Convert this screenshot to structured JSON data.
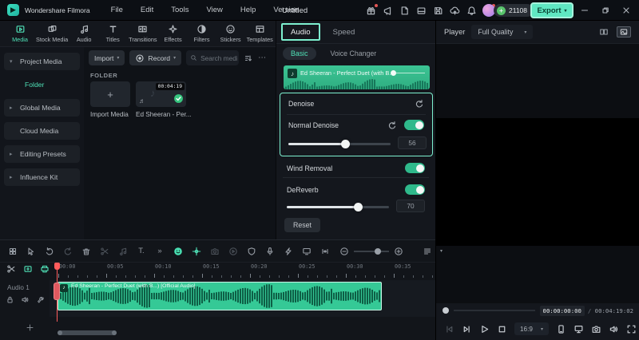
{
  "app": {
    "name": "Wondershare Filmora",
    "menus": [
      {
        "name": "menu-file",
        "label": "File"
      },
      {
        "name": "menu-edit",
        "label": "Edit"
      },
      {
        "name": "menu-tools",
        "label": "Tools"
      },
      {
        "name": "menu-view",
        "label": "View"
      },
      {
        "name": "menu-help",
        "label": "Help"
      },
      {
        "name": "menu-version",
        "label": "Version"
      }
    ],
    "project_title": "Untitled",
    "credits": "21108",
    "export_label": "Export",
    "titlebar_icons": [
      {
        "name": "gift-icon",
        "icon": "gift",
        "dot": true
      },
      {
        "name": "promote-icon",
        "icon": "megaphone"
      },
      {
        "name": "script-icon",
        "icon": "docedit"
      },
      {
        "name": "workspace-icon",
        "icon": "panel"
      },
      {
        "name": "save-icon",
        "icon": "save"
      },
      {
        "name": "cloud-upload-icon",
        "icon": "cloudup"
      },
      {
        "name": "notifications-icon",
        "icon": "bell"
      },
      {
        "name": "apps-icon",
        "icon": "grid",
        "dot": true
      }
    ],
    "window_controls": [
      {
        "name": "minimize-button",
        "icon": "minimize"
      },
      {
        "name": "maximize-button",
        "icon": "maxrestore"
      },
      {
        "name": "close-button",
        "icon": "close"
      }
    ]
  },
  "media_tabs": [
    {
      "name": "tab-media",
      "label": "Media",
      "icon": "mediaicon",
      "active": true
    },
    {
      "name": "tab-stock-media",
      "label": "Stock Media",
      "icon": "stock"
    },
    {
      "name": "tab-audio",
      "label": "Audio",
      "icon": "audionote"
    },
    {
      "name": "tab-titles",
      "label": "Titles",
      "icon": "titles"
    },
    {
      "name": "tab-transitions",
      "label": "Transitions",
      "icon": "transitions"
    },
    {
      "name": "tab-effects",
      "label": "Effects",
      "icon": "fx"
    },
    {
      "name": "tab-filters",
      "label": "Filters",
      "icon": "filters"
    },
    {
      "name": "tab-stickers",
      "label": "Stickers",
      "icon": "stickers"
    },
    {
      "name": "tab-templates",
      "label": "Templates",
      "icon": "templates"
    }
  ],
  "sidebar": [
    {
      "name": "sidebar-item-project-media",
      "label": "Project Media",
      "chevron": "▾"
    },
    {
      "name": "sidebar-item-folder",
      "label": "Folder",
      "active": true,
      "indent": true
    },
    {
      "name": "sidebar-item-global-media",
      "label": "Global Media",
      "chevron": "▸"
    },
    {
      "name": "sidebar-item-cloud-media",
      "label": "Cloud Media"
    },
    {
      "name": "sidebar-item-editing-presets",
      "label": "Editing Presets",
      "chevron": "▸"
    },
    {
      "name": "sidebar-item-influence-kit",
      "label": "Influence Kit",
      "chevron": "▸"
    }
  ],
  "media_panel": {
    "import_label": "Import",
    "record_label": "Record",
    "search_placeholder": "Search media",
    "folder_label": "FOLDER",
    "import_card_label": "Import Media",
    "audio_card": {
      "label": "Ed Sheeran - Per...",
      "duration": "00:04:19"
    }
  },
  "properties": {
    "tabs": [
      {
        "name": "tab-audio-properties",
        "label": "Audio",
        "active": true
      },
      {
        "name": "tab-speed",
        "label": "Speed"
      }
    ],
    "subtabs": [
      {
        "name": "subtab-basic",
        "label": "Basic",
        "active": true
      },
      {
        "name": "subtab-voice-changer",
        "label": "Voice Changer"
      }
    ],
    "clip_title": "Ed Sheeran - Perfect Duet (with B...",
    "denoise_title": "Denoise",
    "normal_denoise": {
      "label": "Normal Denoise",
      "value": 56,
      "max": 100
    },
    "wind_removal_label": "Wind Removal",
    "dereverb": {
      "label": "DeReverb",
      "value": 70,
      "max": 100
    },
    "reset_label": "Reset"
  },
  "player": {
    "label": "Player",
    "quality": "Full Quality",
    "current_time": "00:00:00:00",
    "total_time": "00:04:19:02",
    "aspect_ratio": "16:9",
    "header_icons": [
      {
        "name": "split-preview-icon",
        "icon": "compare"
      },
      {
        "name": "scopes-icon",
        "icon": "scopes",
        "boxed": true
      }
    ],
    "transport": [
      {
        "name": "previous-frame-button",
        "icon": "prevframe",
        "dim": true
      },
      {
        "name": "next-frame-button",
        "icon": "nextframe"
      },
      {
        "name": "play-button",
        "icon": "play"
      },
      {
        "name": "stop-button",
        "icon": "stopsq"
      }
    ],
    "tools": [
      {
        "name": "phone-preview-icon",
        "icon": "phone"
      },
      {
        "name": "mirror-display-icon",
        "icon": "mirror"
      },
      {
        "name": "snapshot-icon",
        "icon": "camera"
      },
      {
        "name": "volume-icon",
        "icon": "volume"
      },
      {
        "name": "fullscreen-icon",
        "icon": "expand"
      }
    ]
  },
  "timeline": {
    "ruler_labels": [
      "00:00",
      "00:05",
      "00:10",
      "00:15",
      "00:20",
      "00:25",
      "00:30",
      "00:35"
    ],
    "track_name": "Audio 1",
    "clip_title": "Ed Sheeran - Perfect Duet (with B...) [Official Audio]",
    "toolbar_icons": [
      {
        "name": "toolbox-icon",
        "icon": "grid"
      },
      {
        "name": "select-icon",
        "icon": "cursor"
      },
      {
        "name": "undo-icon",
        "icon": "undo"
      },
      {
        "name": "redo-icon",
        "icon": "redo",
        "dim": true
      },
      {
        "name": "delete-icon",
        "icon": "trash"
      },
      {
        "name": "split-icon",
        "icon": "scissors",
        "dim": true
      },
      {
        "name": "detach-audio-icon",
        "icon": "detach",
        "dim": true
      },
      {
        "name": "text-tool-icon",
        "glyph": "T."
      },
      {
        "name": "more-tools-icon",
        "glyph": "»"
      },
      {
        "name": "smart-audio-icon",
        "icon": "ai",
        "accent": true
      },
      {
        "name": "keyframe-icon",
        "icon": "keyframe",
        "accent": true
      },
      {
        "name": "snapshot-tool-icon",
        "icon": "camera",
        "dim": true
      },
      {
        "name": "speed-ramp-icon",
        "icon": "clockplay",
        "dim": true
      },
      {
        "name": "mask-icon",
        "icon": "shield"
      },
      {
        "name": "voiceover-icon",
        "icon": "mic"
      },
      {
        "name": "instant-mode-icon",
        "icon": "rocket"
      },
      {
        "name": "screen-record-icon",
        "icon": "screenrec"
      },
      {
        "name": "mark-in-out-icon",
        "icon": "markio"
      }
    ],
    "corner_icons": [
      {
        "name": "razor-icon",
        "icon": "scissors"
      },
      {
        "name": "link-clips-icon",
        "icon": "filmplus",
        "accent": true
      },
      {
        "name": "auto-ripple-icon",
        "icon": "printer",
        "accent": true
      }
    ],
    "track_icons": [
      {
        "name": "lock-icon",
        "icon": "lock"
      },
      {
        "name": "mute-icon",
        "icon": "volume"
      },
      {
        "name": "track-tool-icon",
        "icon": "wrench"
      }
    ]
  },
  "colors": {
    "accent": "#4fe0b6",
    "highlight_border": "#7df0cf",
    "clip_teal": "#35c996",
    "playhead_red": "#ff5c5c",
    "export_bg": "#5fe7c2"
  }
}
